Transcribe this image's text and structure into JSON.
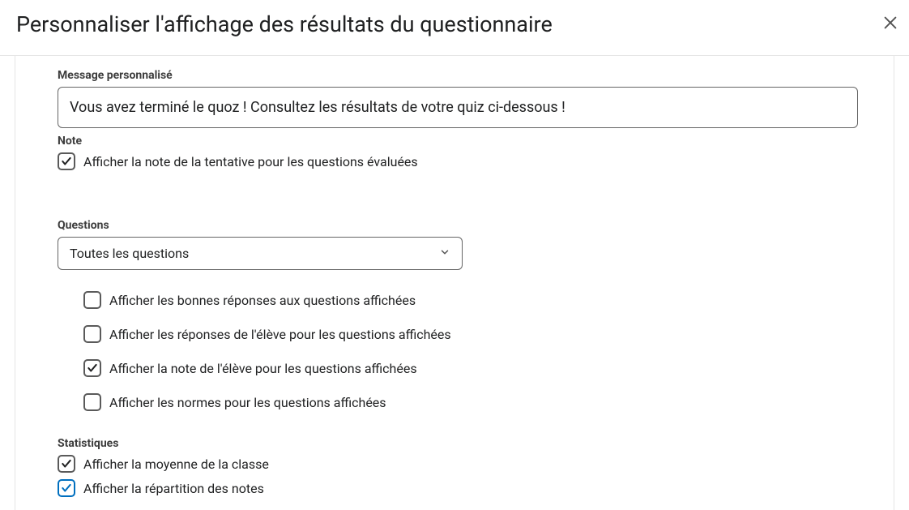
{
  "header": {
    "title": "Personnaliser l'affichage des résultats du questionnaire"
  },
  "fields": {
    "message_label": "Message personnalisé",
    "message_value": "Vous avez terminé le quoz ! Consultez les résultats de votre quiz ci-dessous !"
  },
  "note": {
    "label": "Note",
    "option": "Afficher la note de la tentative pour les questions évaluées"
  },
  "questions": {
    "label": "Questions",
    "selected": "Toutes les questions",
    "options": {
      "correct_answers": "Afficher les bonnes réponses aux questions affichées",
      "student_answers": "Afficher les réponses de l'élève pour les questions affichées",
      "student_grade": "Afficher la note de l'élève pour les questions affichées",
      "standards": "Afficher les normes pour les questions affichées"
    }
  },
  "stats": {
    "label": "Statistiques",
    "class_average": "Afficher la moyenne de la classe",
    "grade_distribution": "Afficher la répartition des notes"
  }
}
